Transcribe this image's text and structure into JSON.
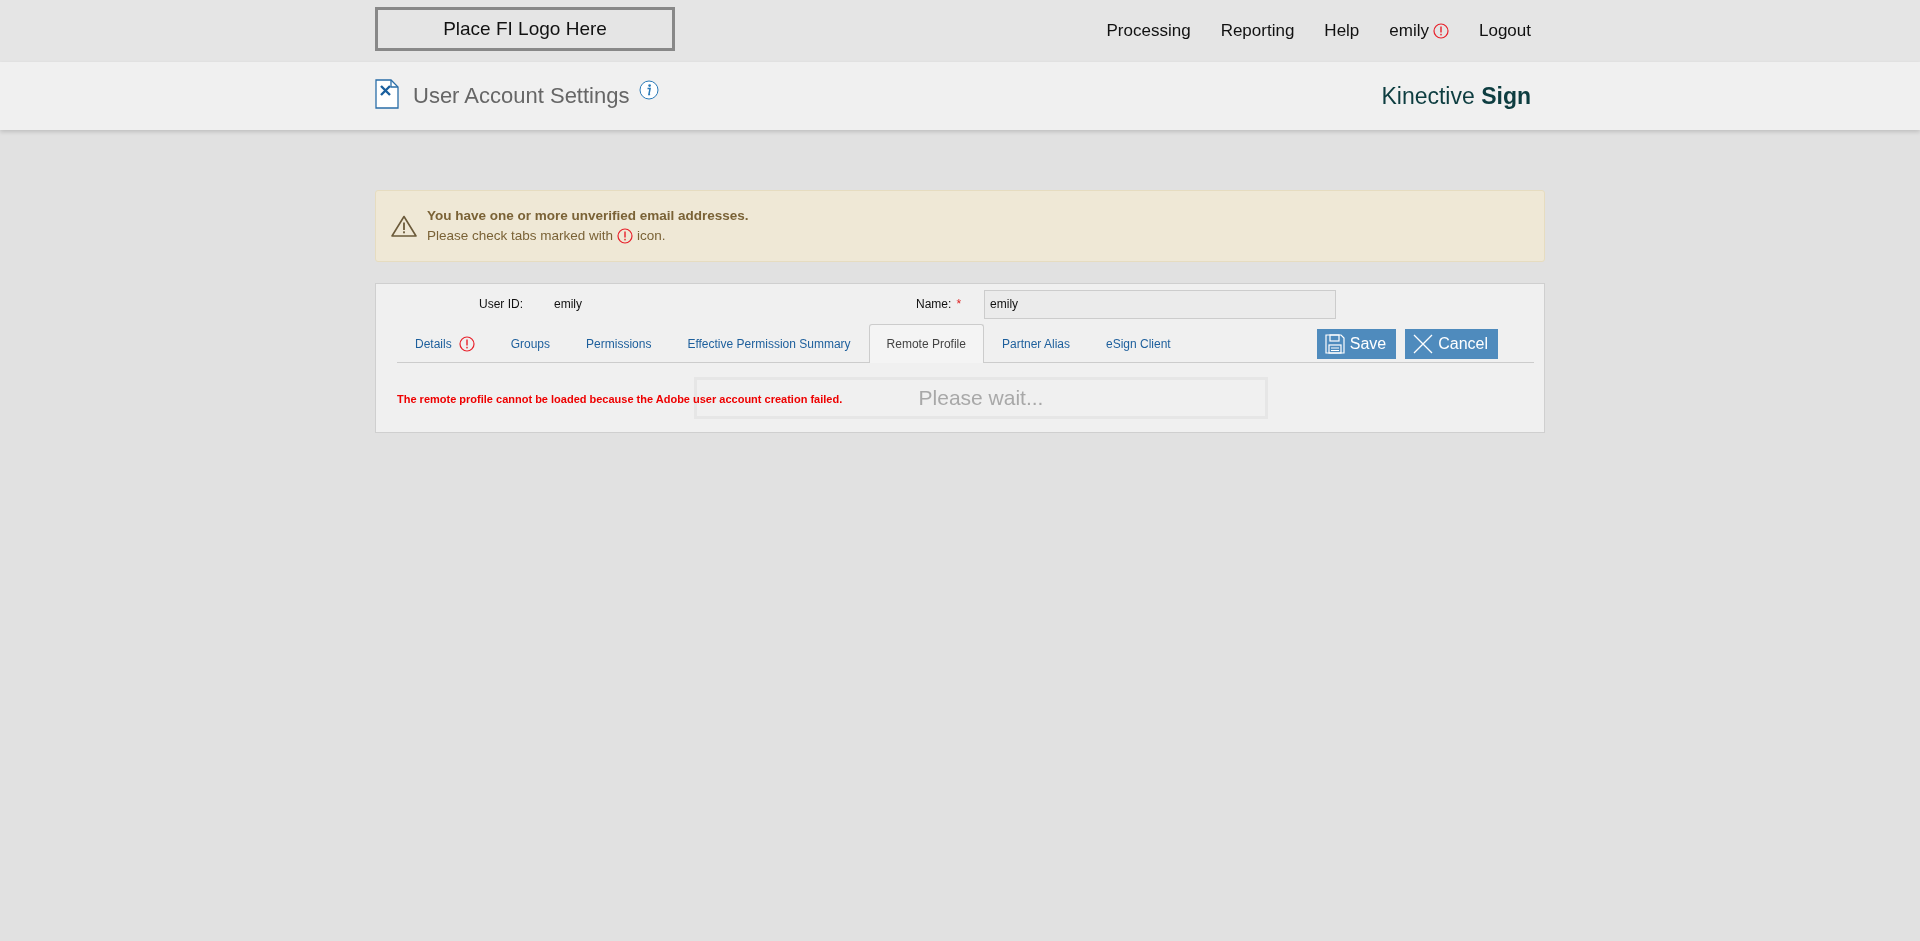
{
  "logo": {
    "text": "Place FI Logo Here"
  },
  "nav": [
    {
      "label": "Processing",
      "alert": false
    },
    {
      "label": "Reporting",
      "alert": false
    },
    {
      "label": "Help",
      "alert": false
    },
    {
      "label": "emily",
      "alert": true
    },
    {
      "label": "Logout",
      "alert": false
    }
  ],
  "page": {
    "title": "User Account Settings",
    "brand_light": "Kinective",
    "brand_bold": "Sign"
  },
  "alert": {
    "heading": "You have one or more unverified email addresses.",
    "text_before": "Please check tabs marked with",
    "text_after": "icon."
  },
  "form": {
    "user_id_label": "User ID:",
    "user_id": "emily",
    "name_label": "Name:",
    "required_mark": "*",
    "name_value": "emily"
  },
  "tabs": [
    {
      "label": "Details",
      "alert": true,
      "selected": false
    },
    {
      "label": "Groups",
      "alert": false,
      "selected": false
    },
    {
      "label": "Permissions",
      "alert": false,
      "selected": false
    },
    {
      "label": "Effective Permission Summary",
      "alert": false,
      "selected": false
    },
    {
      "label": "Remote Profile",
      "alert": false,
      "selected": true
    },
    {
      "label": "Partner Alias",
      "alert": false,
      "selected": false
    },
    {
      "label": "eSign Client",
      "alert": false,
      "selected": false
    }
  ],
  "buttons": [
    {
      "label": "Save",
      "kind": "save"
    },
    {
      "label": "Cancel",
      "kind": "cancel"
    }
  ],
  "error": "The remote profile cannot be loaded because the Adobe user account creation failed.",
  "loading": {
    "text": "Please wait..."
  }
}
